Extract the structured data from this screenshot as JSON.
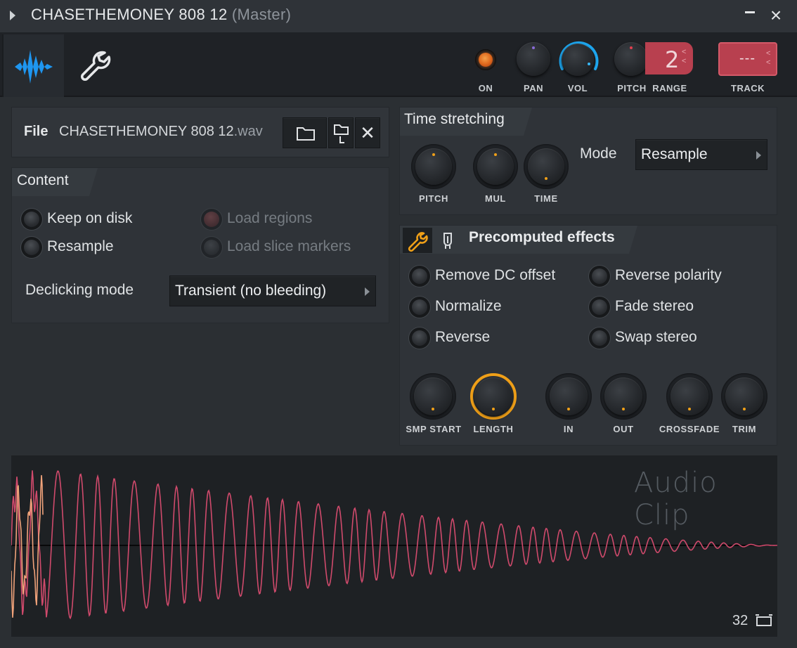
{
  "window": {
    "title": "CHASETHEMONEY 808 12",
    "title_suffix": "(Master)"
  },
  "toolbar": {
    "on_label": "ON",
    "pan_label": "PAN",
    "vol_label": "VOL",
    "pitch_label": "PITCH",
    "range_label": "RANGE",
    "range_value": "2",
    "track_label": "TRACK",
    "track_value": "---"
  },
  "file": {
    "label": "File",
    "name": "CHASETHEMONEY 808 12",
    "ext": ".wav"
  },
  "content": {
    "title": "Content",
    "keep_on_disk": "Keep on disk",
    "resample": "Resample",
    "load_regions": "Load regions",
    "load_slice_markers": "Load slice markers",
    "declicking_label": "Declicking mode",
    "declicking_value": "Transient (no bleeding)"
  },
  "time_stretching": {
    "title": "Time stretching",
    "mode_label": "Mode",
    "mode_value": "Resample",
    "knobs": [
      "PITCH",
      "MUL",
      "TIME"
    ]
  },
  "precomputed": {
    "title": "Precomputed effects",
    "options": {
      "remove_dc": "Remove DC offset",
      "normalize": "Normalize",
      "reverse": "Reverse",
      "reverse_polarity": "Reverse polarity",
      "fade_stereo": "Fade stereo",
      "swap_stereo": "Swap stereo"
    },
    "knobs": {
      "smp_start": "SMP START",
      "length": "LENGTH",
      "in": "IN",
      "out": "OUT",
      "crossfade": "CROSSFADE",
      "trim": "TRIM"
    }
  },
  "waveform": {
    "title": "Audio Clip",
    "zoom_value": "32"
  },
  "colors": {
    "accent_blue": "#1ea7f0",
    "accent_orange": "#f0a018",
    "wave_pink": "#d04a6c",
    "wave_peach": "#f0a27a",
    "track_red": "#b8404f"
  }
}
